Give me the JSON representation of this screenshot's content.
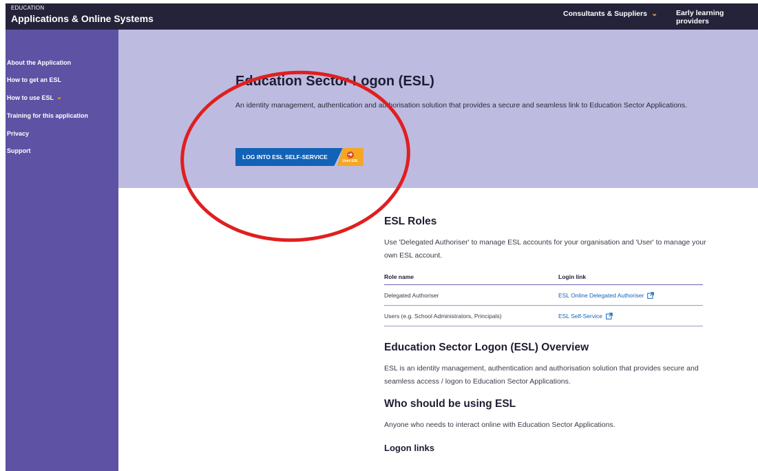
{
  "header": {
    "brand_small": "EDUCATION",
    "brand_title": "Applications & Online Systems",
    "nav": [
      {
        "label": "Consultants & Suppliers",
        "has_dropdown": true
      },
      {
        "label": "Early learning providers",
        "has_dropdown": false
      }
    ]
  },
  "sidebar": {
    "items": [
      {
        "label": "About the Application"
      },
      {
        "label": "How to get an ESL"
      },
      {
        "label": "How to use ESL",
        "has_dropdown": true
      },
      {
        "label": "Training for this application"
      },
      {
        "label": "Privacy"
      },
      {
        "label": "Support"
      }
    ]
  },
  "hero": {
    "title": "Education Sector Logon (ESL)",
    "description": "An identity management, authentication and authorisation solution that provides a secure and seamless link to Education Sector Applications.",
    "button_label": "LOG INTO ESL SELF-SERVICE",
    "badge_label": "Uses ESL"
  },
  "roles": {
    "title": "ESL Roles",
    "intro": "Use 'Delegated Authoriser' to manage ESL accounts for your organisation and 'User' to manage your own ESL account.",
    "headers": [
      "Role name",
      "Login link"
    ],
    "rows": [
      {
        "role": "Delegated Authoriser",
        "link": "ESL Online Delegated Authoriser"
      },
      {
        "role": "Users (e.g. School Administrators, Principals)",
        "link": "ESL Self-Service"
      }
    ]
  },
  "overview": {
    "title": "Education Sector Logon (ESL) Overview",
    "text": "ESL is an identity management, authentication and authorisation solution that provides secure and seamless access / logon to Education Sector Applications."
  },
  "who": {
    "title": "Who should be using ESL",
    "text": "Anyone who needs to interact online with Education Sector Applications."
  },
  "logon_links": {
    "title": "Logon links"
  },
  "colors": {
    "topbar": "#25233a",
    "sidebar": "#5d52a3",
    "hero": "#bdbbe0",
    "primary_button": "#1262b8",
    "accent": "#f2b600",
    "annotation": "#e01f1f"
  }
}
